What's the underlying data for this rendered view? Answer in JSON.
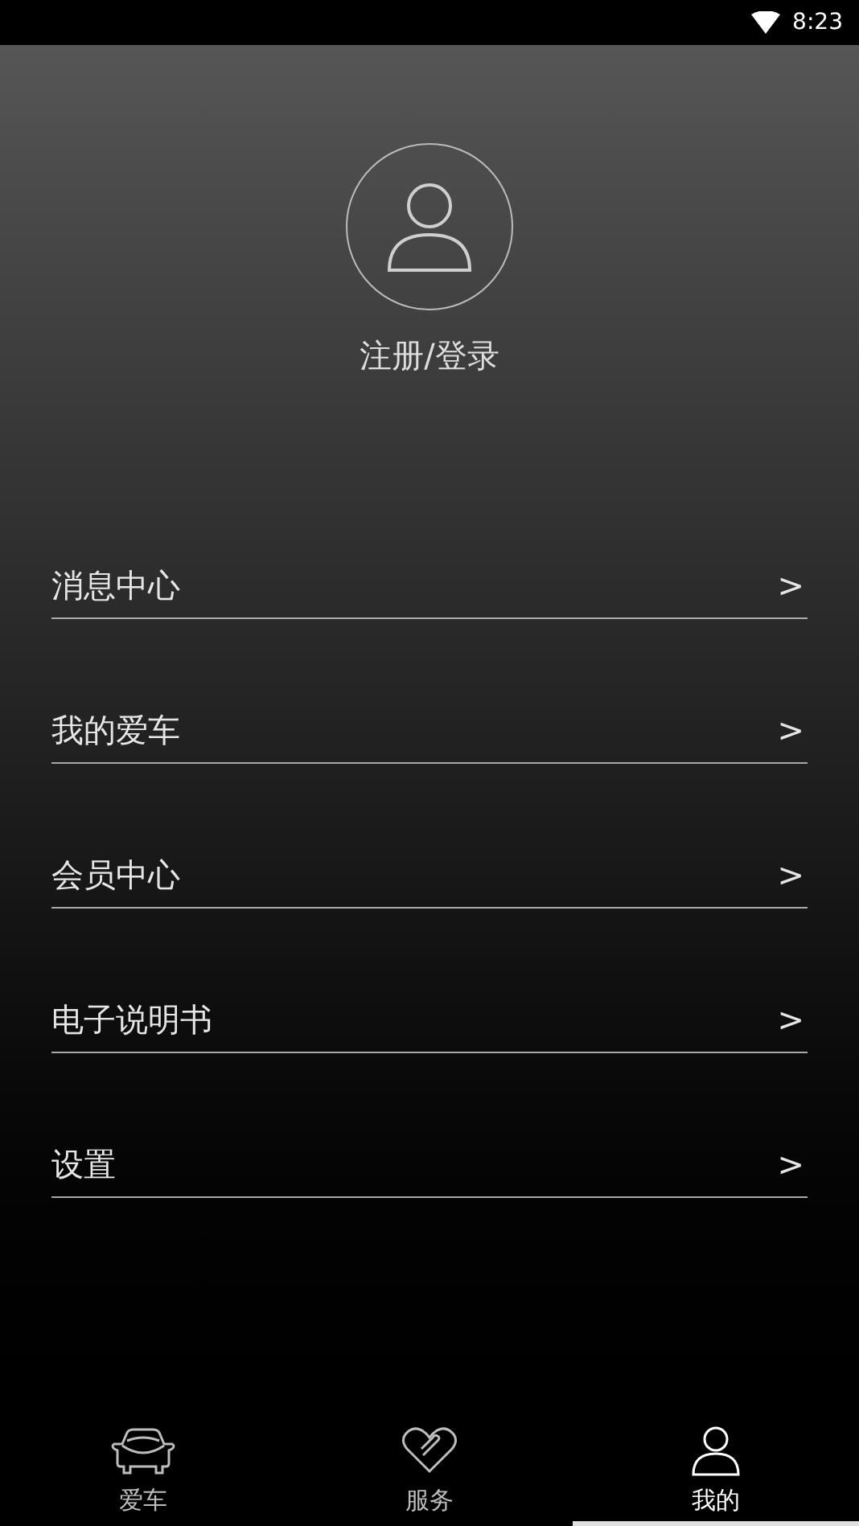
{
  "status_bar": {
    "time": "8:23"
  },
  "profile": {
    "login_label": "注册/登录"
  },
  "menu": [
    {
      "label": "消息中心",
      "chevron": ">"
    },
    {
      "label": "我的爱车",
      "chevron": ">"
    },
    {
      "label": "会员中心",
      "chevron": ">"
    },
    {
      "label": "电子说明书",
      "chevron": ">"
    },
    {
      "label": "设置",
      "chevron": ">"
    }
  ],
  "tabs": [
    {
      "label": "爱车",
      "kind": "car",
      "selected": false
    },
    {
      "label": "服务",
      "kind": "heart",
      "selected": false
    },
    {
      "label": "我的",
      "kind": "person",
      "selected": true
    }
  ]
}
